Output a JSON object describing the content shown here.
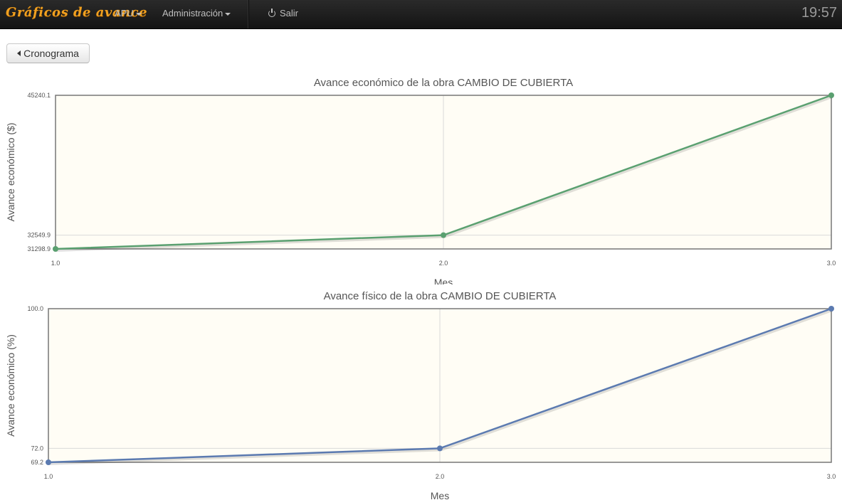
{
  "navbar": {
    "brand": "Gráficos de avance",
    "menu_apu": "APU",
    "menu_admin": "Administración",
    "logout": "Salir",
    "clock": "19:57"
  },
  "back_button": {
    "label": "Cronograma"
  },
  "chart_data": [
    {
      "type": "line",
      "title": "Avance económico de la obra CAMBIO DE CUBIERTA",
      "xlabel": "Mes",
      "ylabel": "Avance económico ($)",
      "x": [
        1.0,
        2.0,
        3.0
      ],
      "values": [
        31298.9,
        32549.9,
        45240.1
      ],
      "xticks": [
        "1.0",
        "2.0",
        "3.0"
      ],
      "yticks": [
        "31298.9",
        "32549.9",
        "45240.1"
      ],
      "xlim": [
        1.0,
        3.0
      ],
      "ylim": [
        31298.9,
        45240.1
      ],
      "color": "#5aa070",
      "background": "#fffdf5",
      "grid": true
    },
    {
      "type": "line",
      "title": "Avance físico de la obra CAMBIO DE CUBIERTA",
      "xlabel": "Mes",
      "ylabel": "Avance económico (%)",
      "x": [
        1.0,
        2.0,
        3.0
      ],
      "values": [
        69.2,
        72.0,
        100.0
      ],
      "xticks": [
        "1.0",
        "2.0",
        "3.0"
      ],
      "yticks": [
        "69.2",
        "72.0",
        "100.0"
      ],
      "xlim": [
        1.0,
        3.0
      ],
      "ylim": [
        69.2,
        100.0
      ],
      "color": "#5b7ab0",
      "background": "#fffdf5",
      "grid": true
    }
  ]
}
